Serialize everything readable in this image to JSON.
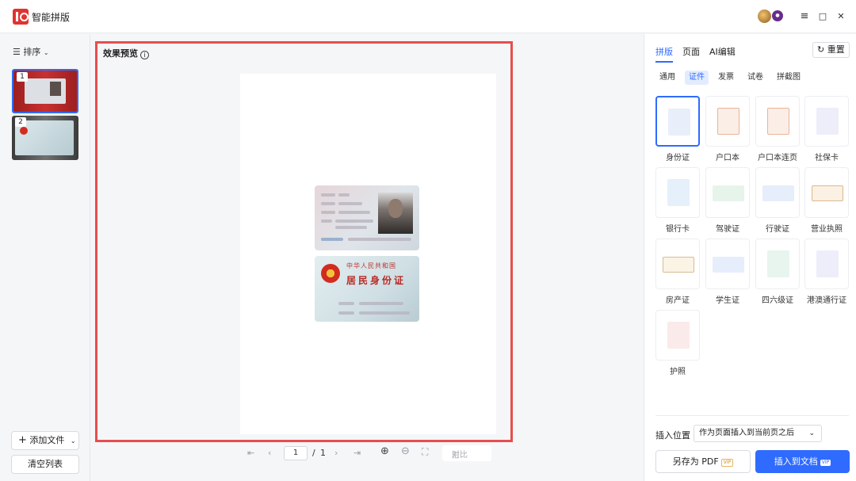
{
  "app": {
    "title": "智能拼版"
  },
  "window": {
    "menu_icon": "≡",
    "maximize_icon": "□",
    "close_icon": "✕"
  },
  "sidebar": {
    "sort_label": "排序",
    "thumbnails": [
      {
        "number": "1"
      },
      {
        "number": "2"
      }
    ],
    "add_file_label": "添加文件",
    "clear_list_label": "清空列表"
  },
  "preview": {
    "title": "效果预览",
    "card_back_line1": "中华人民共和国",
    "card_back_line2": "居民身份证",
    "pager": {
      "current": "1",
      "separator": "/",
      "total": "1",
      "compare_label": "对比"
    }
  },
  "right_panel": {
    "tabs": [
      {
        "label": "拼版"
      },
      {
        "label": "页面"
      },
      {
        "label": "AI编辑"
      }
    ],
    "reset_label": "重置",
    "sub_tabs": [
      {
        "label": "通用"
      },
      {
        "label": "证件"
      },
      {
        "label": "发票"
      },
      {
        "label": "试卷"
      },
      {
        "label": "拼截图"
      }
    ],
    "templates": [
      {
        "label": "身份证"
      },
      {
        "label": "户口本"
      },
      {
        "label": "户口本连页"
      },
      {
        "label": "社保卡"
      },
      {
        "label": "银行卡"
      },
      {
        "label": "驾驶证"
      },
      {
        "label": "行驶证"
      },
      {
        "label": "营业执照"
      },
      {
        "label": "房产证"
      },
      {
        "label": "学生证"
      },
      {
        "label": "四六级证"
      },
      {
        "label": "港澳通行证"
      },
      {
        "label": "护照"
      }
    ],
    "insert_position_label": "插入位置",
    "insert_position_value": "作为页面插入到当前页之后",
    "save_pdf_label": "另存为 PDF",
    "insert_doc_label": "插入到文档",
    "vip_label": "VIP"
  },
  "colors": {
    "accent": "#2f6bff",
    "highlight_border": "#e84d4d",
    "brand": "#e1332f"
  }
}
